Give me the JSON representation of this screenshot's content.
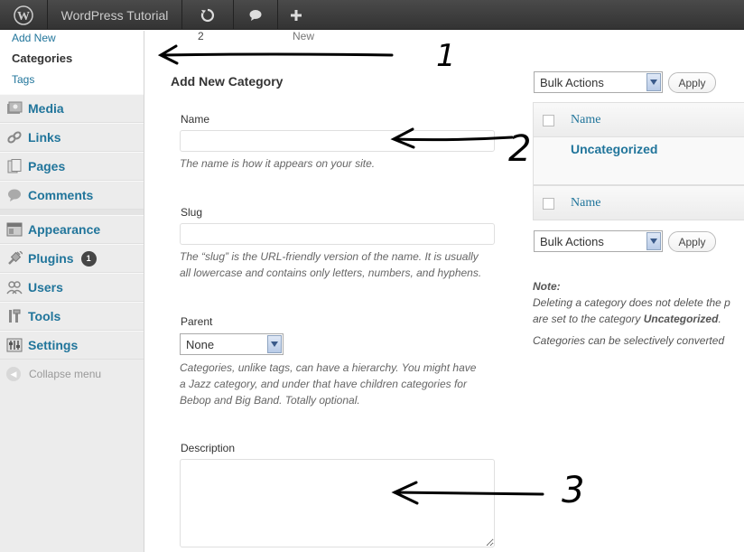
{
  "admin_bar": {
    "site_name": "WordPress Tutorial",
    "updates_count": "2",
    "new_label": "New"
  },
  "sidebar": {
    "submenu": [
      "Add New",
      "Categories",
      "Tags"
    ],
    "items": [
      {
        "label": "Media",
        "icon": "media-icon"
      },
      {
        "label": "Links",
        "icon": "links-icon"
      },
      {
        "label": "Pages",
        "icon": "pages-icon"
      },
      {
        "label": "Comments",
        "icon": "comments-icon"
      },
      {
        "label": "Appearance",
        "icon": "appearance-icon"
      },
      {
        "label": "Plugins",
        "icon": "plugins-icon",
        "badge": "1"
      },
      {
        "label": "Users",
        "icon": "users-icon"
      },
      {
        "label": "Tools",
        "icon": "tools-icon"
      },
      {
        "label": "Settings",
        "icon": "settings-icon"
      }
    ],
    "collapse_label": "Collapse menu"
  },
  "form": {
    "heading": "Add New Category",
    "name_label": "Name",
    "name_value": "",
    "name_desc": "The name is how it appears on your site.",
    "slug_label": "Slug",
    "slug_value": "",
    "slug_desc_1": "The “slug” is the URL-friendly version of the name. It is usually",
    "slug_desc_2": "all lowercase and contains only letters, numbers, and hyphens.",
    "parent_label": "Parent",
    "parent_selected": "None",
    "parent_desc_1": "Categories, unlike tags, can have a hierarchy. You might have",
    "parent_desc_2": "a Jazz category, and under that have children categories for",
    "parent_desc_3": "Bebop and Big Band. Totally optional.",
    "description_label": "Description",
    "description_value": ""
  },
  "list": {
    "bulk_actions": "Bulk Actions",
    "apply": "Apply",
    "col_name": "Name",
    "row_name": "Uncategorized",
    "note_label": "Note:",
    "note_line1": "Deleting a category does not delete the p",
    "note_line2_prefix": "are set to the category ",
    "note_line2_bold": "Uncategorized",
    "note_line2_suffix": ".",
    "note_line3": "Categories can be selectively converted"
  },
  "annotations": [
    "1",
    "2",
    "3"
  ],
  "colors": {
    "admin_bar": "#333333",
    "link": "#21759b",
    "sidebar": "#ececec"
  }
}
